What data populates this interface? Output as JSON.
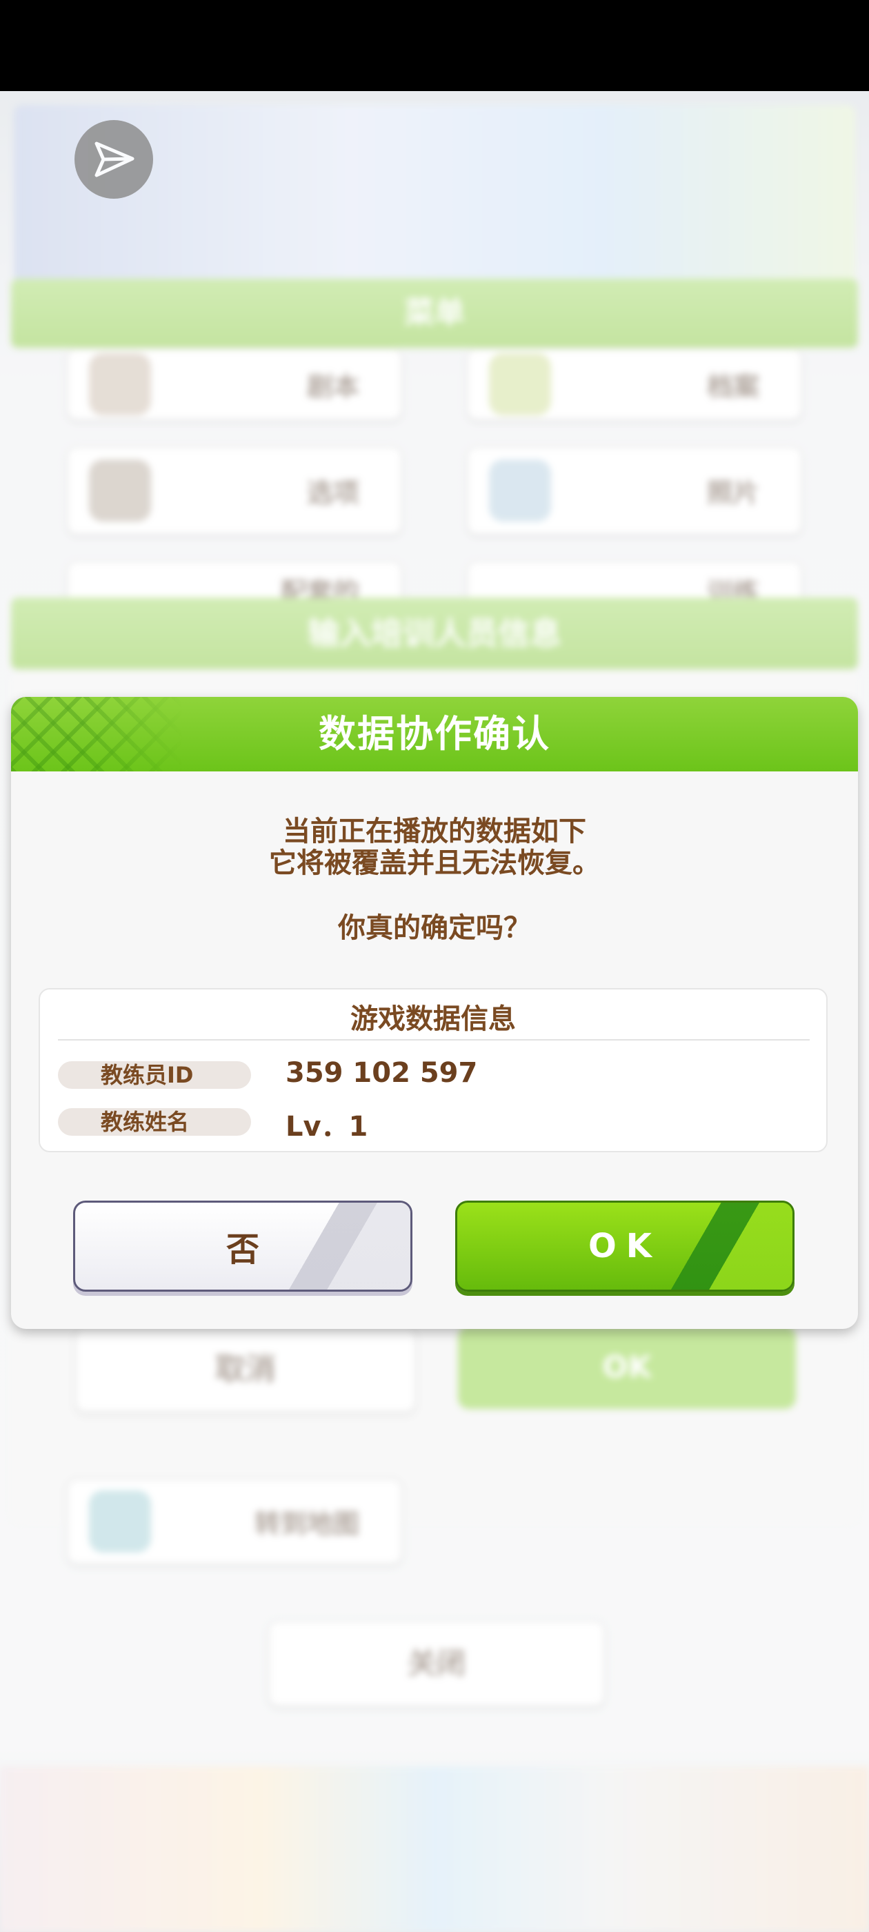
{
  "background": {
    "menu_header": "菜单",
    "menu_items": [
      "剧本",
      "档案",
      "选项",
      "照片",
      "配套的",
      "训练"
    ],
    "section_header": "输入培训人员信息",
    "underlay_buttons": {
      "cancel": "取消",
      "ok": "OK"
    },
    "lower_item": "转到地图",
    "close_button": "关闭"
  },
  "dialog": {
    "title": "数据协作确认",
    "message_line1": "当前正在播放的数据如下",
    "message_line2": "它将被覆盖并且无法恢复。",
    "question": "你真的确定吗？",
    "info": {
      "title": "游戏数据信息",
      "rows": [
        {
          "label": "教练员ID",
          "value": "359 102 597"
        },
        {
          "label": "教练姓名",
          "value": "Lv．1"
        }
      ]
    },
    "buttons": {
      "no": "否",
      "ok": "OK"
    }
  },
  "colors": {
    "header_green": "#6cc41a",
    "ok_green": "#7fcc12",
    "text_brown": "#7a4a22"
  },
  "icons": [
    "share-icon"
  ]
}
